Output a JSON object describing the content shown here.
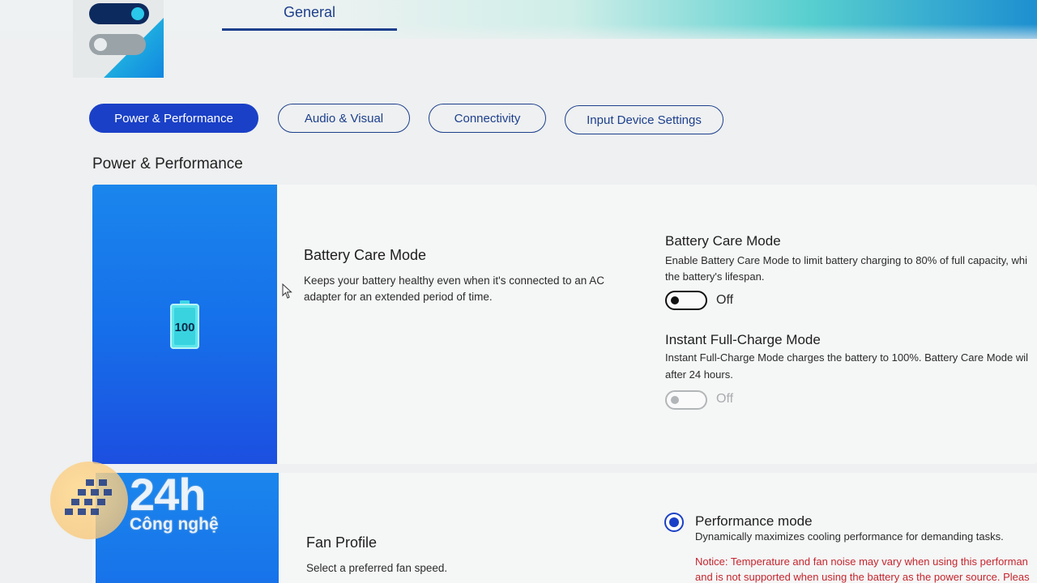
{
  "header": {
    "tab_general": "General"
  },
  "category_tabs": [
    {
      "label": "Power & Performance",
      "active": true
    },
    {
      "label": "Audio & Visual",
      "active": false
    },
    {
      "label": "Connectivity",
      "active": false
    },
    {
      "label": "Input Device Settings",
      "active": false
    }
  ],
  "section": {
    "title": "Power & Performance"
  },
  "battery_card": {
    "battery_level": "100",
    "title": "Battery Care Mode",
    "description_line1": "Keeps your battery healthy even when it's connected to an AC",
    "description_line2": "adapter for an extended period of time.",
    "settings": {
      "battery_care": {
        "title": "Battery Care Mode",
        "desc_line1": "Enable Battery Care Mode to limit battery charging to 80% of full capacity, whi",
        "desc_line2": "the battery's lifespan.",
        "state": "Off"
      },
      "instant_full_charge": {
        "title": "Instant Full-Charge Mode",
        "desc_line1": "Instant Full-Charge Mode charges the battery to 100%. Battery Care Mode wil",
        "desc_line2": "after 24 hours.",
        "state": "Off"
      }
    }
  },
  "fan_card": {
    "title": "Fan Profile",
    "description": "Select a preferred fan speed.",
    "option": {
      "title": "Performance mode",
      "description": "Dynamically maximizes cooling performance for demanding tasks.",
      "notice_line1": "Notice: Temperature and fan noise may vary when using this performan",
      "notice_line2": "and is not supported when using the battery as the power source. Pleas"
    }
  },
  "watermark": {
    "brand": "24h",
    "sub": "Công nghệ"
  },
  "colors": {
    "accent": "#1a40c7",
    "nav_text": "#1d3f8c",
    "card_blue": "#1670ea",
    "notice_red": "#c4262e"
  }
}
